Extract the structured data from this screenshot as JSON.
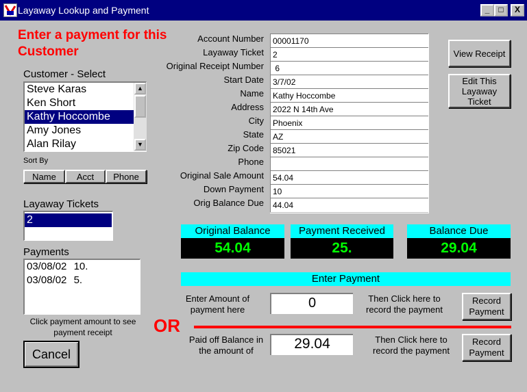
{
  "window": {
    "title": "Layaway Lookup and Payment",
    "buttons": {
      "minimize": "_",
      "maximize": "□",
      "close": "X"
    }
  },
  "heading": {
    "line1": "Enter a payment for this",
    "line2": "Customer"
  },
  "customer_select": {
    "label": "Customer - Select",
    "items": [
      "Steve Karas",
      "Ken Short",
      "Kathy Hoccombe",
      "Amy Jones",
      "Alan Rilay"
    ],
    "selected": "Kathy Hoccombe"
  },
  "sort_by": {
    "label": "Sort By",
    "buttons": [
      "Name",
      "Acct",
      "Phone"
    ]
  },
  "layaway_tickets": {
    "label": "Layaway Tickets",
    "items": [
      "2"
    ]
  },
  "payments": {
    "label": "Payments",
    "items": [
      {
        "date": "03/08/02",
        "amount": "10."
      },
      {
        "date": "03/08/02",
        "amount": "5."
      }
    ],
    "hint_line1": "Click payment amount to see",
    "hint_line2": "payment receipt"
  },
  "cancel_label": "Cancel",
  "fields": [
    {
      "label": "Account Number",
      "value": "00001170"
    },
    {
      "label": "Layaway Ticket",
      "value": "2"
    },
    {
      "label": "Original Receipt Number",
      "value": " 6"
    },
    {
      "label": "Start Date",
      "value": "3/7/02"
    },
    {
      "label": "Name",
      "value": "Kathy Hoccombe"
    },
    {
      "label": "Address",
      "value": "2022 N 14th Ave"
    },
    {
      "label": "City",
      "value": "Phoenix"
    },
    {
      "label": "State",
      "value": "AZ"
    },
    {
      "label": "Zip Code",
      "value": "85021"
    },
    {
      "label": "Phone",
      "value": ""
    },
    {
      "label": "Original Sale Amount",
      "value": "54.04"
    },
    {
      "label": "Down Payment",
      "value": "10"
    },
    {
      "label": "Orig Balance Due",
      "value": "44.04"
    }
  ],
  "view_receipt_label": "View Receipt",
  "edit_ticket_label": [
    "Edit This",
    "Layaway",
    "Ticket"
  ],
  "summary": {
    "original_balance": {
      "label": "Original Balance",
      "value": "54.04"
    },
    "payment_received": {
      "label": "Payment Received",
      "value": "25."
    },
    "balance_due": {
      "label": "Balance Due",
      "value": "29.04"
    }
  },
  "enter_payment": {
    "header": "Enter Payment",
    "amount_label": [
      "Enter Amount of",
      "payment here"
    ],
    "amount_value": "0",
    "then_click": [
      "Then Click here to",
      "record the payment"
    ],
    "record_label": [
      "Record",
      "Payment"
    ],
    "or_label": "OR",
    "payoff_label": [
      "Paid off Balance in",
      "the amount of"
    ],
    "payoff_value": "29.04",
    "then_click2": [
      "Then Click here to",
      "record the payment"
    ]
  },
  "colors": {
    "accent_red": "#ff0000",
    "cyan": "#00ffff",
    "green_value": "#00ff00",
    "title_bar": "#000080"
  }
}
